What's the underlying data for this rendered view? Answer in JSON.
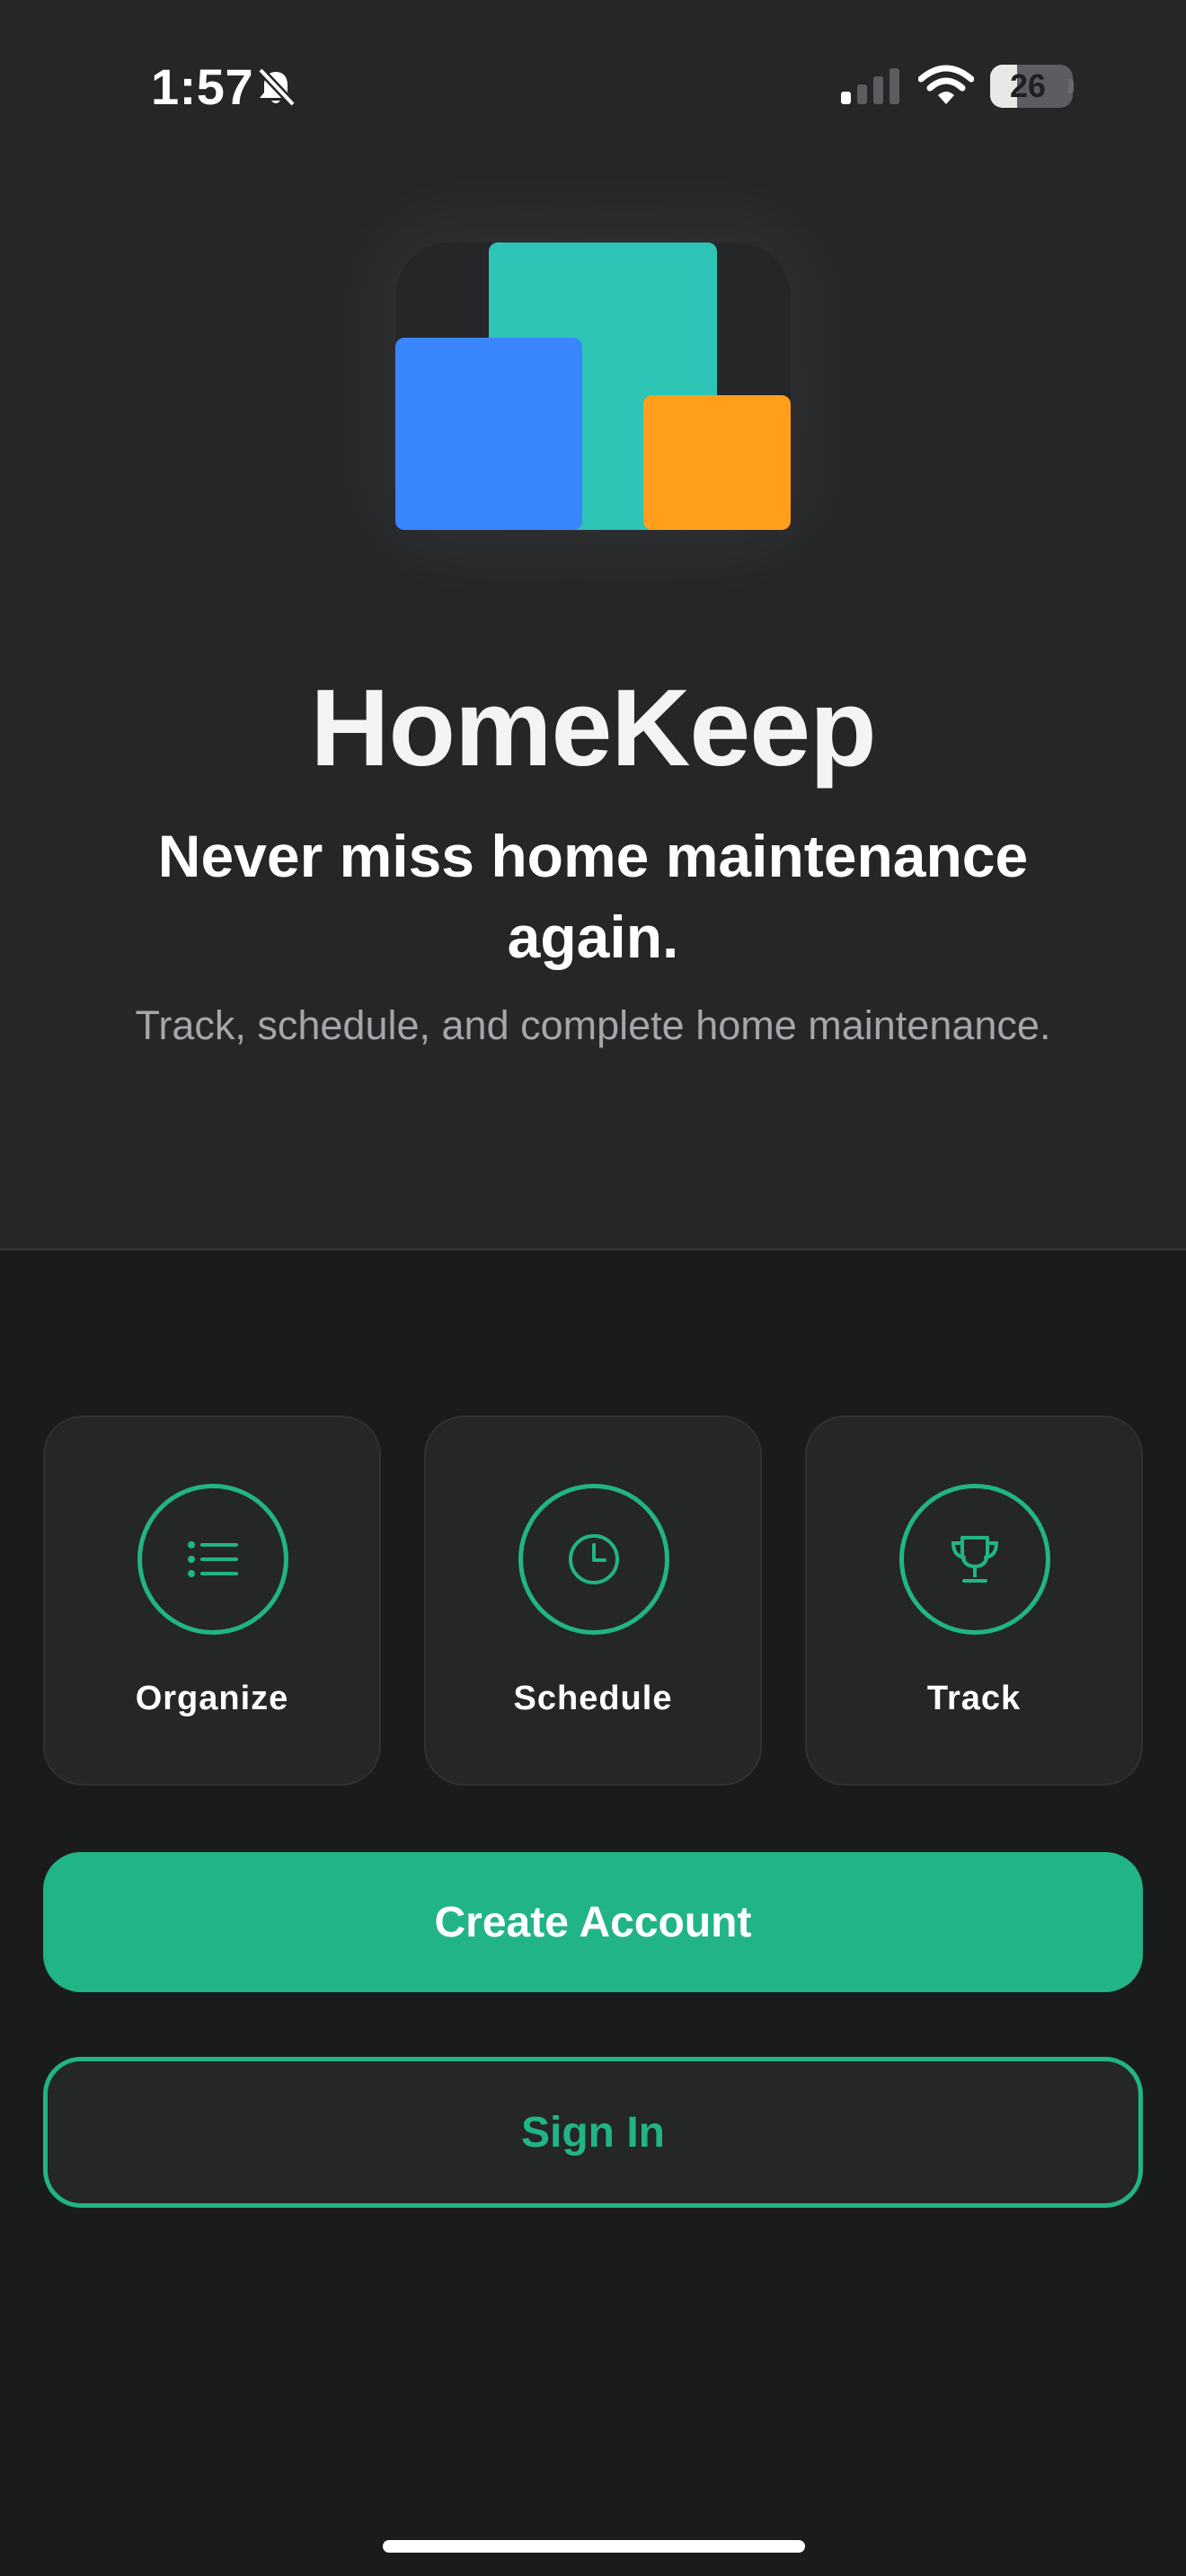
{
  "status_bar": {
    "time": "1:57",
    "battery_level": "26",
    "battery_fraction": 0.26,
    "icons": [
      "bell-slash-icon",
      "signal-icon",
      "wifi-icon",
      "battery-icon"
    ]
  },
  "hero": {
    "logo_colors": {
      "teal": "#2ec4b6",
      "blue": "#3a86ff",
      "orange": "#ff9f1c"
    },
    "app_name": "HomeKeep",
    "tagline": "Never miss home maintenance again.",
    "subtitle": "Track, schedule, and complete home maintenance."
  },
  "features": [
    {
      "label": "Organize",
      "icon": "list-icon"
    },
    {
      "label": "Schedule",
      "icon": "clock-icon"
    },
    {
      "label": "Track",
      "icon": "trophy-icon"
    }
  ],
  "actions": {
    "create_account_label": "Create Account",
    "sign_in_label": "Sign In"
  },
  "theme": {
    "accent": "#21b487",
    "background": "#1a1b1d",
    "surface": "#252628"
  }
}
